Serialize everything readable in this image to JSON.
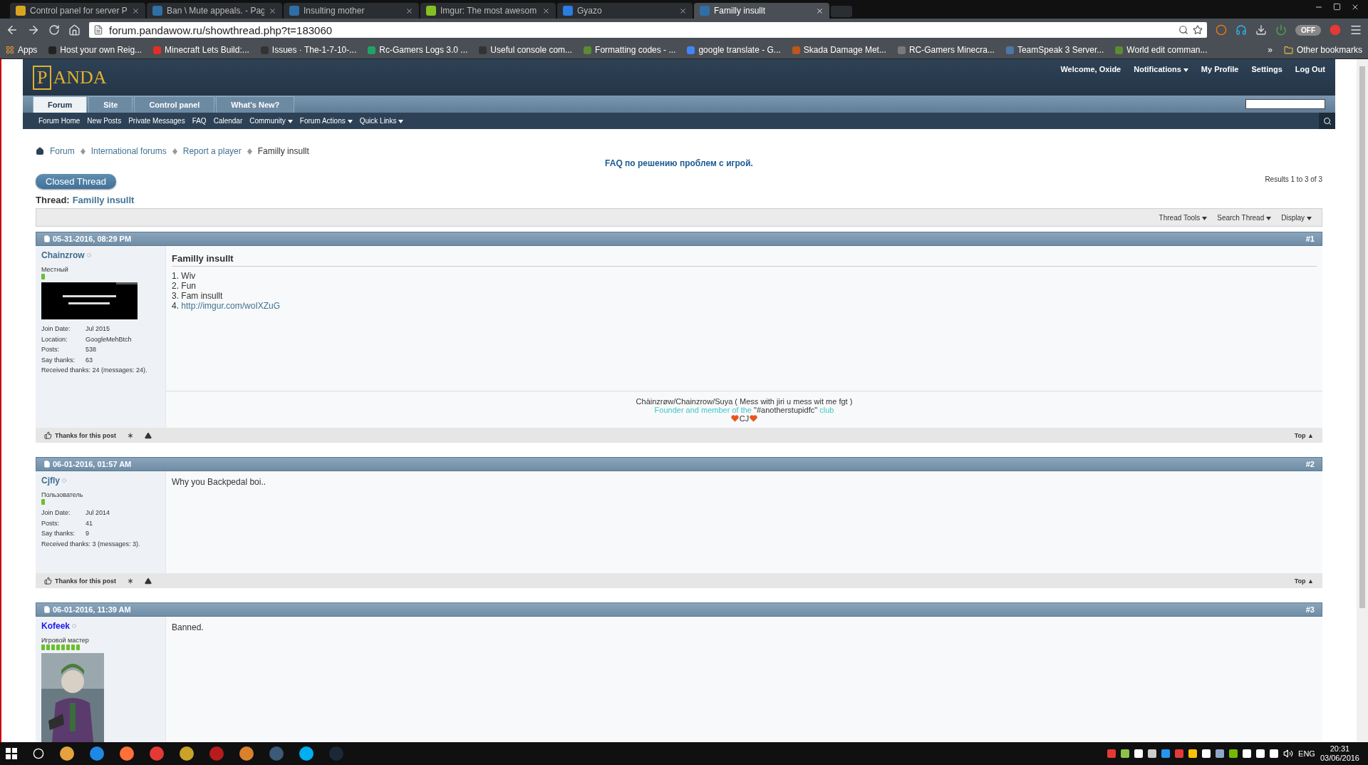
{
  "browser": {
    "tabs": [
      {
        "title": "Control panel for server P",
        "selected": false,
        "color": "#d9a520"
      },
      {
        "title": "Ban \\ Mute appeals. - Pag",
        "selected": false,
        "color": "#2f6fa6"
      },
      {
        "title": "Insulting mother",
        "selected": false,
        "color": "#2f6fa6"
      },
      {
        "title": "Imgur: The most awesom",
        "selected": false,
        "color": "#85bf25"
      },
      {
        "title": "Gyazo",
        "selected": false,
        "color": "#2a7de1"
      },
      {
        "title": "Familly insullt",
        "selected": true,
        "color": "#2f6fa6"
      }
    ],
    "address": "forum.pandawow.ru/showthread.php?t=183060",
    "toggle": {
      "label": "OFF",
      "on": false
    },
    "apps": "Apps",
    "bookmarks": [
      {
        "title": "Host your own Reig...",
        "color": "#222222"
      },
      {
        "title": "Minecraft Lets Build:...",
        "color": "#e52d27"
      },
      {
        "title": "Issues · The-1-7-10-...",
        "color": "#333333"
      },
      {
        "title": "Rc-Gamers Logs 3.0 ...",
        "color": "#21a366"
      },
      {
        "title": "Useful console com...",
        "color": "#333333"
      },
      {
        "title": "Formatting codes - ...",
        "color": "#5b8c32"
      },
      {
        "title": "google translate - G...",
        "color": "#4285f4"
      },
      {
        "title": "Skada Damage Met...",
        "color": "#c0561c"
      },
      {
        "title": "RC-Gamers Minecra...",
        "color": "#7a7a7a"
      },
      {
        "title": "TeamSpeak 3 Server...",
        "color": "#4a78a8"
      },
      {
        "title": "World edit comman...",
        "color": "#5b8c32"
      }
    ],
    "more_bookmarks": "»",
    "other_bookmarks": "Other bookmarks"
  },
  "forum": {
    "logo_initial": "P",
    "logo_rest": "ANDA",
    "welcome": "Welcome,",
    "user": "Oxide",
    "user_links": [
      {
        "label": "Notifications",
        "dropdown": true
      },
      {
        "label": "My Profile",
        "dropdown": false
      },
      {
        "label": "Settings",
        "dropdown": false
      },
      {
        "label": "Log Out",
        "dropdown": false
      }
    ],
    "nav_tabs": [
      {
        "label": "Forum",
        "selected": true
      },
      {
        "label": "Site",
        "selected": false
      },
      {
        "label": "Control panel",
        "selected": false
      },
      {
        "label": "What's New?",
        "selected": false
      }
    ],
    "subnav": [
      {
        "label": "Forum Home",
        "dropdown": false
      },
      {
        "label": "New Posts",
        "dropdown": false
      },
      {
        "label": "Private Messages",
        "dropdown": false
      },
      {
        "label": "FAQ",
        "dropdown": false
      },
      {
        "label": "Calendar",
        "dropdown": false
      },
      {
        "label": "Community",
        "dropdown": true
      },
      {
        "label": "Forum Actions",
        "dropdown": true
      },
      {
        "label": "Quick Links",
        "dropdown": true
      }
    ],
    "breadcrumb": [
      {
        "label": "Forum",
        "current": false
      },
      {
        "label": "International forums",
        "current": false
      },
      {
        "label": "Report a player",
        "current": false
      },
      {
        "label": "Familly insullt",
        "current": true
      }
    ],
    "notice": "FAQ по решению проблем с игрой.",
    "closed_button": "Closed Thread",
    "results": "Results 1 to 3 of 3",
    "thread_label": "Thread:",
    "thread_title": "Familly insullt",
    "thread_tools": [
      {
        "label": "Thread Tools",
        "dropdown": true
      },
      {
        "label": "Search Thread",
        "dropdown": true
      },
      {
        "label": "Display",
        "dropdown": true
      }
    ],
    "posts": [
      {
        "date": "05-31-2016, 08:29 PM",
        "number": "#1",
        "username": "Chainzrow",
        "color": "#3e6d8e",
        "rank": "Местный",
        "reputation": [
          {
            "kind": "pip"
          }
        ],
        "avatar": {
          "kind": "banner"
        },
        "details": [
          {
            "label": "Join Date:",
            "value": "Jul 2015"
          },
          {
            "label": "Location:",
            "value": "GoogleMehBtch"
          },
          {
            "label": "Posts:",
            "value": "538"
          },
          {
            "label": "Say thanks:",
            "value": "63"
          }
        ],
        "received": "Received thanks: 24 (messages: 24).",
        "title": "Familly insullt",
        "body": [
          {
            "kind": "item",
            "number": "1.",
            "text": "Wiv"
          },
          {
            "kind": "item",
            "number": "2.",
            "text": "Fun"
          },
          {
            "kind": "item",
            "number": "3.",
            "text": "Fam insullt"
          },
          {
            "kind": "link",
            "number": "4.",
            "text": "http://imgur.com/woIXZuG"
          }
        ],
        "signature": {
          "line": "Chàinzrøw/Chainzrow/Suya ( Mess with jiri u mess wit me fgt )",
          "parts": [
            {
              "text": "Founder and member of the",
              "kind": "accent"
            },
            {
              "text": "\"#anotherstupidfc\"",
              "kind": "plain"
            },
            {
              "text": "club",
              "kind": "accent"
            }
          ],
          "mark": "CJ"
        },
        "thanks": "Thanks for this post",
        "top": "Top ▲"
      },
      {
        "date": "06-01-2016, 01:57 AM",
        "number": "#2",
        "username": "Cjfly",
        "color": "#3e6d8e",
        "rank": "Пользователь",
        "reputation": [
          {
            "kind": "pip"
          }
        ],
        "details": [
          {
            "label": "Join Date:",
            "value": "Jul 2014"
          },
          {
            "label": "Posts:",
            "value": "41"
          },
          {
            "label": "Say thanks:",
            "value": "9"
          }
        ],
        "received": "Received thanks: 3 (messages: 3).",
        "body": [
          {
            "kind": "text",
            "text": "Why you Backpedal boi.."
          }
        ],
        "thanks": "Thanks for this post",
        "top": "Top ▲"
      },
      {
        "date": "06-01-2016, 11:39 AM",
        "number": "#3",
        "username": "Kofeek",
        "color": "#1a1aee",
        "rank": "Игровой мастер",
        "reputation": [
          {
            "kind": "pip"
          },
          {
            "kind": "pip"
          },
          {
            "kind": "pip"
          },
          {
            "kind": "pip"
          },
          {
            "kind": "pip"
          },
          {
            "kind": "pip"
          },
          {
            "kind": "pip"
          },
          {
            "kind": "pip"
          }
        ],
        "avatar": {
          "kind": "portrait"
        },
        "body": [
          {
            "kind": "text",
            "text": "Banned."
          }
        ]
      }
    ]
  },
  "taskbar": {
    "apps": [
      {
        "color": "#e6a23c"
      },
      {
        "color": "#1e88e5"
      },
      {
        "color": "#ff7139"
      },
      {
        "color": "#e53935"
      },
      {
        "color": "#c9a227"
      },
      {
        "color": "#b71c1c"
      },
      {
        "color": "#d9822b"
      },
      {
        "color": "#3a5a78"
      },
      {
        "color": "#00aff0"
      },
      {
        "color": "#1b2838"
      }
    ],
    "tray": [
      {
        "color": "#e53935"
      },
      {
        "color": "#8bc34a"
      },
      {
        "color": "#ffffff"
      },
      {
        "color": "#cccccc"
      },
      {
        "color": "#2196f3"
      },
      {
        "color": "#e53935"
      },
      {
        "color": "#ffc107"
      },
      {
        "color": "#ffffff"
      },
      {
        "color": "#8fa8c8"
      },
      {
        "color": "#76b900"
      },
      {
        "color": "#ffffff"
      },
      {
        "color": "#ffffff"
      },
      {
        "color": "#ffffff"
      }
    ],
    "language": "ENG",
    "time": "20:31",
    "date": "03/06/2016"
  }
}
